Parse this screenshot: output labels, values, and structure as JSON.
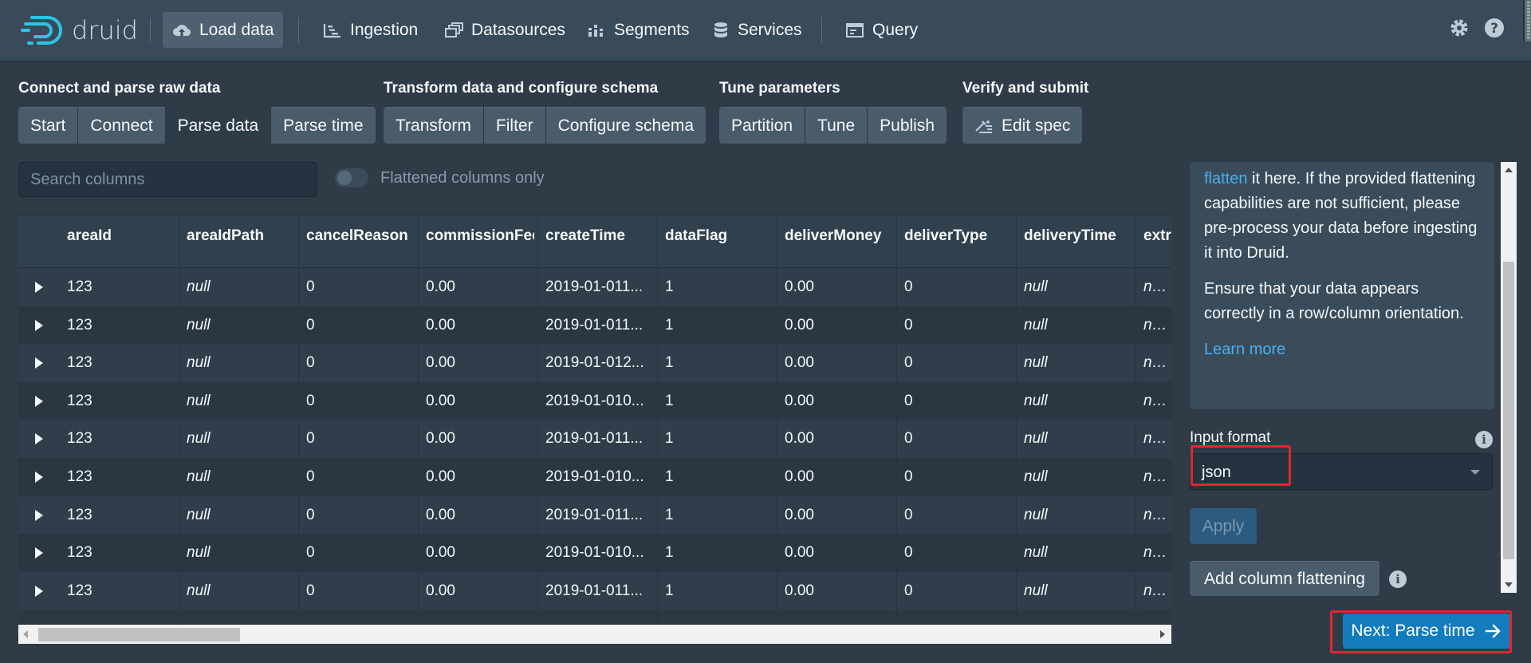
{
  "app": {
    "brand": "druid"
  },
  "nav": {
    "load_data": "Load data",
    "ingestion": "Ingestion",
    "datasources": "Datasources",
    "segments": "Segments",
    "services": "Services",
    "query": "Query"
  },
  "steps": {
    "groups": [
      {
        "title": "Connect and parse raw data",
        "items": [
          "Start",
          "Connect",
          "Parse data",
          "Parse time"
        ]
      },
      {
        "title": "Transform data and configure schema",
        "items": [
          "Transform",
          "Filter",
          "Configure schema"
        ]
      },
      {
        "title": "Tune parameters",
        "items": [
          "Partition",
          "Tune",
          "Publish"
        ]
      },
      {
        "title": "Verify and submit",
        "items": [
          "Edit spec"
        ]
      }
    ],
    "active": "Parse data"
  },
  "search": {
    "placeholder": "Search columns",
    "value": ""
  },
  "toggle": {
    "label": "Flattened columns only",
    "on": false
  },
  "table": {
    "columns": [
      "areaId",
      "areaIdPath",
      "cancelReason",
      "commissionFee",
      "createTime",
      "dataFlag",
      "deliverMoney",
      "deliverType",
      "deliveryTime",
      "extra"
    ],
    "rows": [
      [
        "123",
        "null",
        "0",
        "0.00",
        "2019-01-011...",
        "1",
        "0.00",
        "0",
        "null",
        "null"
      ],
      [
        "123",
        "null",
        "0",
        "0.00",
        "2019-01-011...",
        "1",
        "0.00",
        "0",
        "null",
        "null"
      ],
      [
        "123",
        "null",
        "0",
        "0.00",
        "2019-01-012...",
        "1",
        "0.00",
        "0",
        "null",
        "null"
      ],
      [
        "123",
        "null",
        "0",
        "0.00",
        "2019-01-010...",
        "1",
        "0.00",
        "0",
        "null",
        "null"
      ],
      [
        "123",
        "null",
        "0",
        "0.00",
        "2019-01-011...",
        "1",
        "0.00",
        "0",
        "null",
        "null"
      ],
      [
        "123",
        "null",
        "0",
        "0.00",
        "2019-01-010...",
        "1",
        "0.00",
        "0",
        "null",
        "null"
      ],
      [
        "123",
        "null",
        "0",
        "0.00",
        "2019-01-011...",
        "1",
        "0.00",
        "0",
        "null",
        "null"
      ],
      [
        "123",
        "null",
        "0",
        "0.00",
        "2019-01-010...",
        "1",
        "0.00",
        "0",
        "null",
        "null"
      ],
      [
        "123",
        "null",
        "0",
        "0.00",
        "2019-01-011...",
        "1",
        "0.00",
        "0",
        "null",
        "null"
      ]
    ]
  },
  "panel": {
    "info_link_flatten": "flatten",
    "info_text_1": " it here. If the provided flattening capabilities are not sufficient, please pre-process your data before ingesting it into Druid.",
    "info_text_2": "Ensure that your data appears correctly in a row/column orientation.",
    "learn_more": "Learn more",
    "input_format_label": "Input format",
    "input_format_value": "json",
    "apply": "Apply",
    "add_flattening": "Add column flattening",
    "next": "Next: Parse time"
  },
  "colors": {
    "highlight": "#e5262c",
    "primary": "#137cbd",
    "link": "#48aff0"
  }
}
